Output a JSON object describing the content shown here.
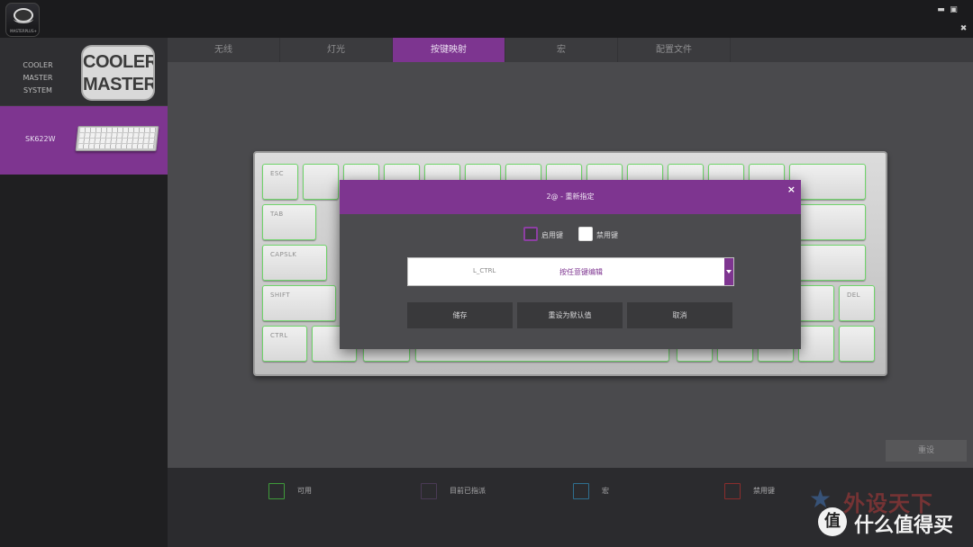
{
  "app": {
    "logo_text": "MASTERPLUS+"
  },
  "window_controls": {
    "minimize_icon": "minimize-icon",
    "maximize_icon": "maximize-icon",
    "tools_icon": "tools-icon"
  },
  "sidebar": {
    "devices": [
      {
        "name_line1": "COOLER MASTER",
        "name_line2": "SYSTEM",
        "logo_line1": "COOLER",
        "logo_line2": "MASTER",
        "selected": false
      },
      {
        "name": "SK622W",
        "selected": true
      }
    ]
  },
  "tabs": [
    {
      "label": "无线",
      "active": false
    },
    {
      "label": "灯光",
      "active": false
    },
    {
      "label": "按键映射",
      "active": true
    },
    {
      "label": "宏",
      "active": false
    },
    {
      "label": "配置文件",
      "active": false
    }
  ],
  "keyboard": {
    "keys": {
      "esc": "ESC",
      "tab": "TAB",
      "capslk": "CAPSLK",
      "shift": "SHIFT",
      "ctrl": "CTRL",
      "del": "DEL"
    }
  },
  "reset_button": "重设",
  "legend": [
    {
      "label": "可用",
      "color": "#3f9b3a"
    },
    {
      "label": "目前已指派",
      "color": "#4a3a55"
    },
    {
      "label": "宏",
      "color": "#2f6f8f"
    },
    {
      "label": "禁用键",
      "color": "#8a2d2d"
    }
  ],
  "watermark": {
    "top": "外设天下",
    "badge": "值",
    "text": "什么值得买"
  },
  "dialog": {
    "title": "2@ - 重新指定",
    "close": "×",
    "enable_label": "启用键",
    "disable_label": "禁用键",
    "current_key": "L_CTRL",
    "select_hint": "按任意键编辑",
    "save": "储存",
    "reset_default": "重设为默认值",
    "cancel": "取消"
  },
  "colors": {
    "accent": "#7e3590",
    "key_glow": "#6fd46a"
  }
}
